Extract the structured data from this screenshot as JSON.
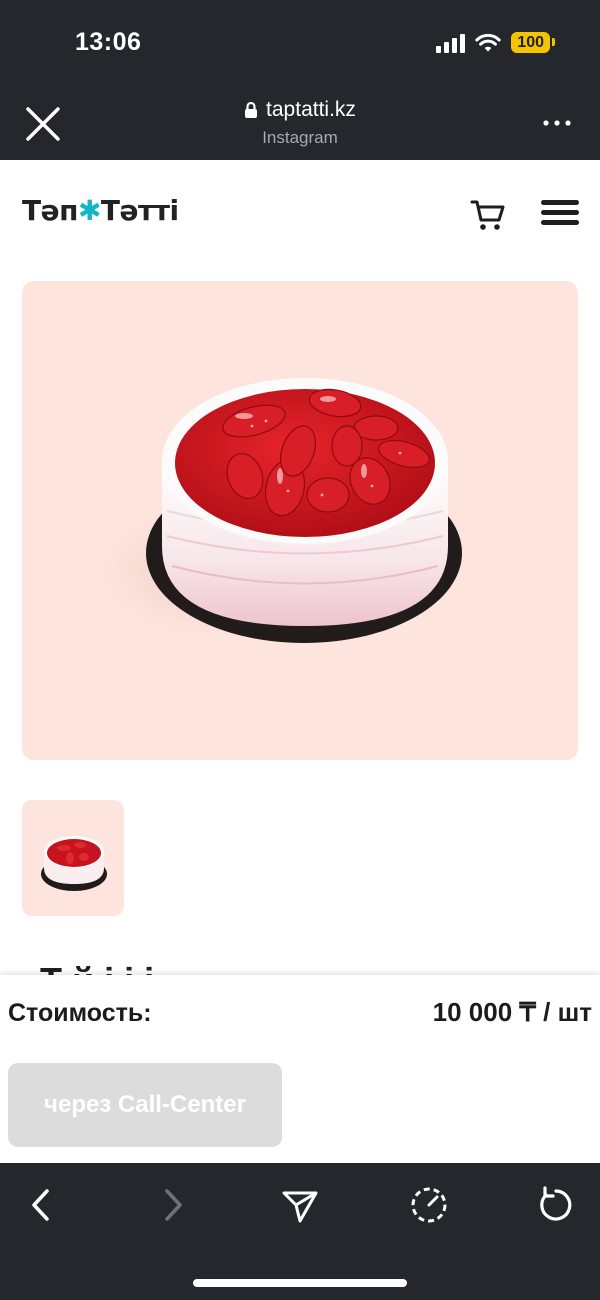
{
  "status_bar": {
    "time": "13:06",
    "battery": "100",
    "battery_color": "#f5c400"
  },
  "browser": {
    "url": "taptatti.kz",
    "source": "Instagram",
    "close_icon": "close-icon",
    "more_icon": "more-dots-icon",
    "lock_icon": "lock-icon"
  },
  "site": {
    "logo": {
      "part1": "Тəп",
      "part2": "Тəттi"
    },
    "cart_icon": "cart-icon",
    "menu_icon": "hamburger-menu-icon"
  },
  "product": {
    "image_bg": "#fde4dc",
    "title_partial": "Т        й        і     і  і"
  },
  "price_panel": {
    "label": "Стоимость:",
    "value": "10 000 ₸ / шт",
    "button_label": "через Call-Center"
  },
  "toolbar": {
    "icons": [
      "back-icon",
      "forward-icon",
      "share-icon",
      "speed-dial-icon",
      "reload-icon"
    ]
  }
}
